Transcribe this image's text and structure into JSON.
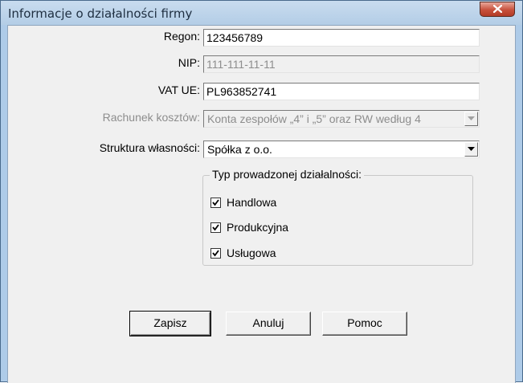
{
  "window": {
    "title": "Informacje o działalności firmy"
  },
  "form": {
    "regon": {
      "label": "Regon:",
      "value": "123456789"
    },
    "nip": {
      "label": "NIP:",
      "value": "111-111-11-11"
    },
    "vat_ue": {
      "label": "VAT UE:",
      "value": "PL963852741"
    },
    "rachunek_kosztow": {
      "label": "Rachunek kosztów:",
      "value": "Konta zespołów „4” i „5” oraz RW według 4"
    },
    "struktura_wlasnosci": {
      "label": "Struktura własności:",
      "value": "Spółka z o.o."
    }
  },
  "activity_group": {
    "legend": "Typ prowadzonej działalności:",
    "items": [
      {
        "label": "Handlowa",
        "checked": true
      },
      {
        "label": "Produkcyjna",
        "checked": true
      },
      {
        "label": "Usługowa",
        "checked": true
      }
    ]
  },
  "buttons": {
    "save": "Zapisz",
    "cancel": "Anuluj",
    "help": "Pomoc"
  }
}
